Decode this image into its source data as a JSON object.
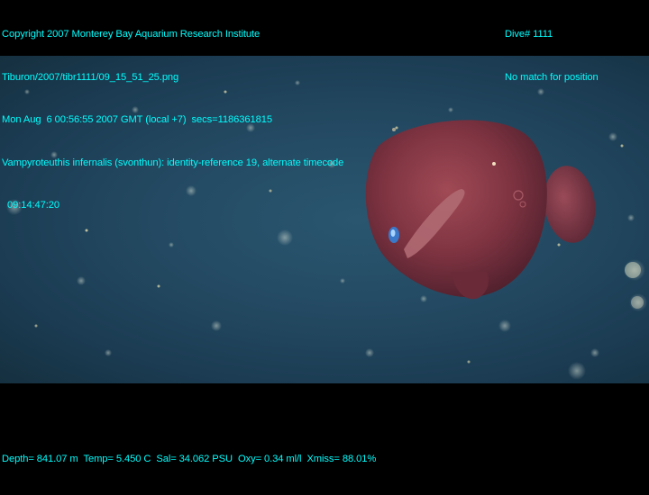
{
  "header": {
    "line1": "Copyright 2007 Monterey Bay Aquarium Research Institute",
    "line2": "Tiburon/2007/tibr1111/09_15_51_25.png",
    "line3": "Mon Aug  6 00:56:55 2007 GMT (local +7)  secs=1186361815",
    "line4": "Vampyroteuthis infernalis (svonthun): identity-reference 19, alternate timecode",
    "line5": "  09:14:47:20"
  },
  "header_right": {
    "dive": "Dive# 1111",
    "position": "No match for position"
  },
  "footer": {
    "telemetry": "Depth= 841.07 m  Temp= 5.450 C  Sal= 34.062 PSU  Oxy= 0.34 ml/l  Xmiss= 88.01%"
  },
  "colors": {
    "overlay_text": "#00ffff",
    "water": "#234a62",
    "animal": "#8a3a45"
  }
}
